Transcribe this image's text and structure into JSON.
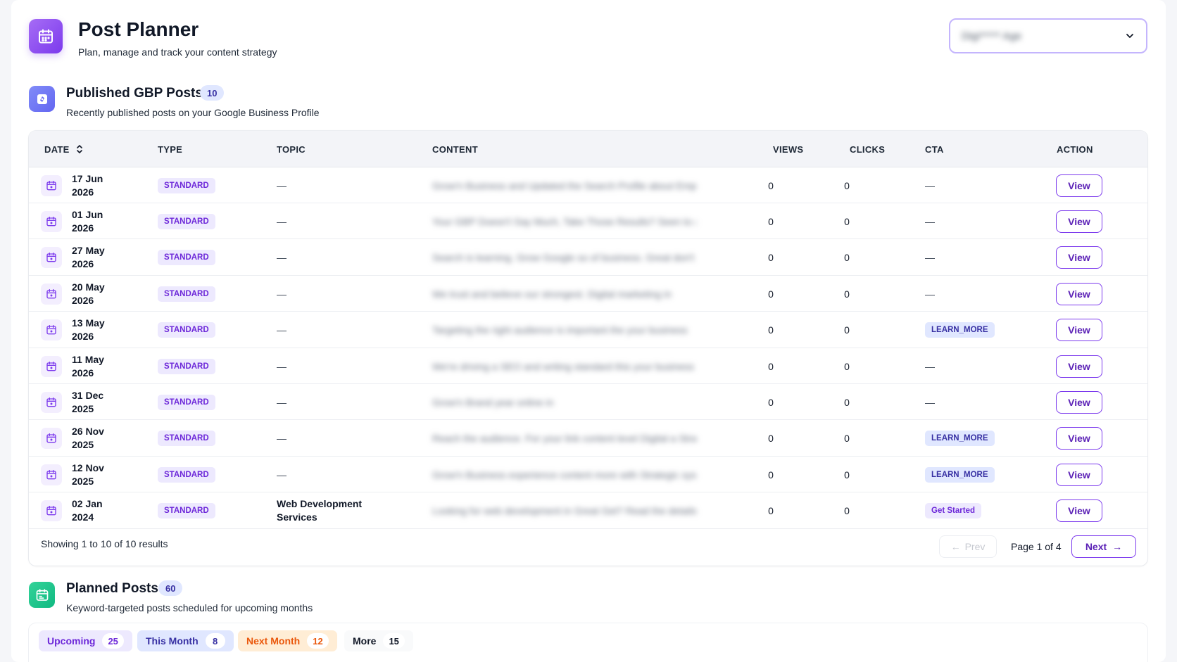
{
  "header": {
    "title": "Post Planner",
    "subtitle": "Plan, manage and track your content strategy",
    "account_select": {
      "value": "Digi***** Age"
    }
  },
  "published": {
    "title": "Published GBP Posts",
    "count": "10",
    "subtitle": "Recently published posts on your Google Business Profile",
    "columns": [
      "DATE",
      "TYPE",
      "TOPIC",
      "CONTENT",
      "VIEWS",
      "CLICKS",
      "CTA",
      "ACTION"
    ],
    "rows": [
      {
        "date": "17 Jun\n2026",
        "type": "STANDARD",
        "topic": "—",
        "content": "Grow'n Business and Updated the Search Profile about Employees",
        "views": "0",
        "clicks": "0",
        "cta": "—",
        "action": "View"
      },
      {
        "date": "01 Jun\n2026",
        "type": "STANDARD",
        "topic": "—",
        "content": "Your GBP Doesn't Say Much, Take Those Results? Seen to a way",
        "views": "0",
        "clicks": "0",
        "cta": "—",
        "action": "View"
      },
      {
        "date": "27 May\n2026",
        "type": "STANDARD",
        "topic": "—",
        "content": "Search is learning. Grow Google so of business. Great don't",
        "views": "0",
        "clicks": "0",
        "cta": "—",
        "action": "View"
      },
      {
        "date": "20 May\n2026",
        "type": "STANDARD",
        "topic": "—",
        "content": "We trust and believe our strongest. Digital marketing in",
        "views": "0",
        "clicks": "0",
        "cta": "—",
        "action": "View"
      },
      {
        "date": "13 May\n2026",
        "type": "STANDARD",
        "topic": "—",
        "content": "Targeting the right audience is important the your business",
        "views": "0",
        "clicks": "0",
        "cta": "LEARN_MORE",
        "action": "View"
      },
      {
        "date": "11 May\n2026",
        "type": "STANDARD",
        "topic": "—",
        "content": "We're driving a SEO and writing standard this your business",
        "views": "0",
        "clicks": "0",
        "cta": "—",
        "action": "View"
      },
      {
        "date": "31 Dec\n2025",
        "type": "STANDARD",
        "topic": "—",
        "content": "Grow'n Brand year online in",
        "views": "0",
        "clicks": "0",
        "cta": "—",
        "action": "View"
      },
      {
        "date": "26 Nov\n2025",
        "type": "STANDARD",
        "topic": "—",
        "content": "Reach the audience. For your link content level Digital a Strategic",
        "views": "0",
        "clicks": "0",
        "cta": "LEARN_MORE",
        "action": "View"
      },
      {
        "date": "12 Nov\n2025",
        "type": "STANDARD",
        "topic": "—",
        "content": "Grow'n Business experience content more with Strategic systems",
        "views": "0",
        "clicks": "0",
        "cta": "LEARN_MORE",
        "action": "View"
      },
      {
        "date": "02 Jan\n2024",
        "type": "STANDARD",
        "topic": "Web Development\nServices",
        "content": "Looking for web development in Great Get? Read the details",
        "views": "0",
        "clicks": "0",
        "cta": "Get Started",
        "action": "View"
      }
    ],
    "footer": {
      "showing": "Showing 1 to 10 of 10 results",
      "prev": "Prev",
      "page_info": "Page 1 of 4",
      "next": "Next"
    }
  },
  "planned": {
    "title": "Planned Posts",
    "count": "60",
    "subtitle": "Keyword-targeted posts scheduled for upcoming months",
    "tabs": [
      {
        "label": "Upcoming",
        "count": "25",
        "bg": "#ede9fe",
        "fg": "#6d28d9"
      },
      {
        "label": "This Month",
        "count": "8",
        "bg": "#e0e7ff",
        "fg": "#3730a3"
      },
      {
        "label": "Next Month",
        "count": "12",
        "bg": "#ffedd5",
        "fg": "#ea580c"
      },
      {
        "label": "More",
        "count": "15",
        "bg": "#f9fafb",
        "fg": "#111827"
      }
    ]
  },
  "colors": {
    "accent": "#7c3aed",
    "planned_icon": "#10b981"
  }
}
